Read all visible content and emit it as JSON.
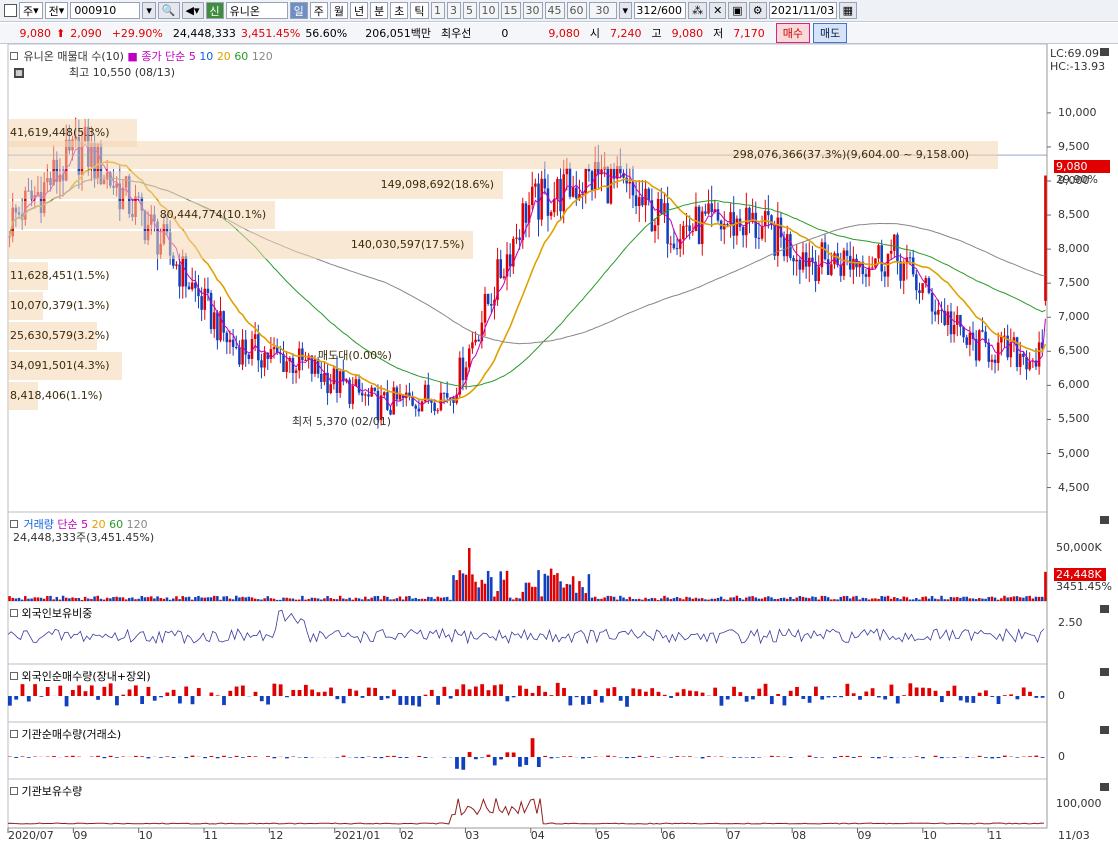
{
  "toolbar": {
    "period": "주",
    "mode": "전",
    "code": "000910",
    "name": "유니온",
    "badge": "신",
    "tabs": [
      "일",
      "주",
      "월",
      "년",
      "분",
      "초",
      "틱"
    ],
    "intervals": [
      "1",
      "3",
      "5",
      "10",
      "15",
      "30",
      "45",
      "60"
    ],
    "interval_value": "30",
    "count": "312/600",
    "date": "2021/11/03"
  },
  "quote": {
    "price": "9,080",
    "change": "2,090",
    "change_pct": "+29.90%",
    "volume": "24,448,333",
    "volume_pct": "3,451.45%",
    "ratio": "56.60%",
    "amount": "206,051백만",
    "preferred_label": "최우선",
    "preferred_value": "0",
    "quote_price": "9,080",
    "open_label": "시",
    "open": "7,240",
    "high_label": "고",
    "high": "9,080",
    "low_label": "저",
    "low": "7,170",
    "buy": "매수",
    "sell": "매도"
  },
  "price_panel": {
    "title": "유니온 매물대 수(10)",
    "ma_label": "종가 단순",
    "ma_periods": [
      "5",
      "10",
      "20",
      "60",
      "120"
    ],
    "lc": "LC:69.09",
    "hc": "HC:-13.93",
    "high_note": "최고 10,550 (08/13)",
    "low_note": "최저 5,370 (02/01)",
    "last_price": "9,080",
    "last_pct": "29.90%",
    "axis": [
      "10,000",
      "9,500",
      "9,000",
      "8,500",
      "8,000",
      "7,500",
      "7,000",
      "6,500",
      "6,000",
      "5,500",
      "5,000",
      "4,500"
    ],
    "volume_profile": [
      {
        "label": "41,619,448(5.3%)",
        "price": 9700,
        "frac": 0.13
      },
      {
        "label": "298,076,366(37.3%)(9,604.00 ~ 9,158.00)",
        "price": 9381,
        "frac": 1.0
      },
      {
        "label": "149,098,692(18.6%)",
        "price": 8939,
        "frac": 0.5
      },
      {
        "label": "80,444,774(10.1%)",
        "price": 8500,
        "frac": 0.27
      },
      {
        "label": "140,030,597(17.5%)",
        "price": 8055,
        "frac": 0.47
      },
      {
        "label": "11,628,451(1.5%)",
        "price": 7611,
        "frac": 0.04
      },
      {
        "label": "10,070,379(1.3%)",
        "price": 7170,
        "frac": 0.035
      },
      {
        "label": "25,630,579(3.2%)",
        "price": 6727,
        "frac": 0.09
      },
      {
        "label": "34,091,501(4.3%)",
        "price": 6284,
        "frac": 0.115
      },
      {
        "label": "8,418,406(1.1%)",
        "price": 5842,
        "frac": 0.03
      }
    ],
    "ma_note": "매도대(0.00%)"
  },
  "volume_panel": {
    "title": "거래량",
    "ma_label": "단순",
    "ma_periods": [
      "5",
      "20",
      "60",
      "120"
    ],
    "value": "24,448,333주(3,451.45%)",
    "axis": "50,000K",
    "last": "24,448K",
    "last_pct": "3451.45%"
  },
  "foreign_panel": {
    "title": "외국인보유비중",
    "axis": "2.50"
  },
  "foreign_net_panel": {
    "title": "외국인순매수량(장내+장외)",
    "axis": "0"
  },
  "inst_net_panel": {
    "title": "기관순매수량(거래소)",
    "axis": "0"
  },
  "inst_hold_panel": {
    "title": "기관보유수량",
    "axis": "100,000"
  },
  "x_axis": [
    "2020/07",
    "09",
    "10",
    "11",
    "12",
    "2021/01",
    "02",
    "03",
    "04",
    "05",
    "06",
    "07",
    "08",
    "09",
    "10",
    "11",
    "11/03"
  ],
  "colors": {
    "up": "#e00000",
    "down": "#1040c0",
    "ma5": "#c000c0",
    "ma20": "#e0a000",
    "ma60": "#2a9a2a",
    "ma120": "#888888",
    "profile": "#f2d6b0"
  },
  "chart_data": {
    "type": "candlestick",
    "x": [
      "2020/07",
      "09",
      "10",
      "11",
      "12",
      "2021/01",
      "02",
      "03",
      "04",
      "05",
      "06",
      "07",
      "08",
      "09",
      "10",
      "11"
    ],
    "close": [
      8400,
      9500,
      8200,
      6600,
      6300,
      5700,
      5900,
      8600,
      9100,
      8300,
      8400,
      7800,
      7900,
      6600,
      6400,
      9080
    ],
    "ylim": [
      4200,
      10600
    ],
    "last": {
      "open": 7240,
      "high": 9080,
      "low": 7170,
      "close": 9080
    }
  }
}
